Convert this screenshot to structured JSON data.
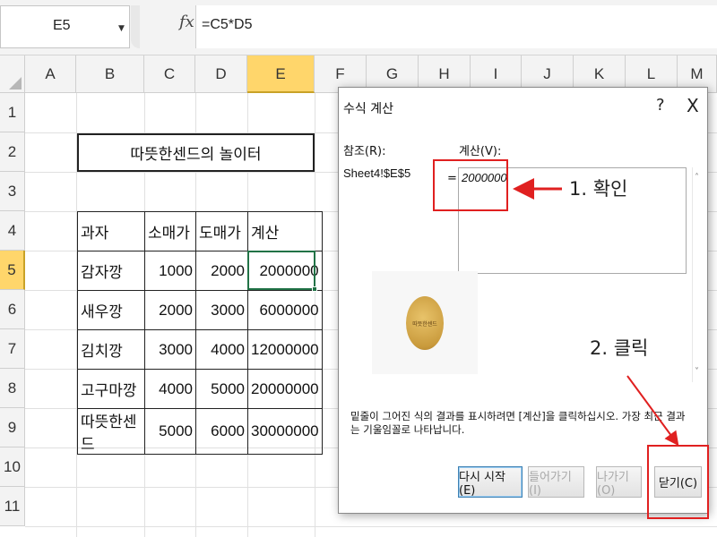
{
  "formula_bar": {
    "name_box": "E5",
    "fx_icon": "fx",
    "formula": "=C5*D5"
  },
  "columns": [
    "A",
    "B",
    "C",
    "D",
    "E",
    "F",
    "G",
    "H",
    "I",
    "J",
    "K",
    "L",
    "M"
  ],
  "rows": [
    "1",
    "2",
    "3",
    "4",
    "5",
    "6",
    "7",
    "8",
    "9",
    "10",
    "11"
  ],
  "active_cell": {
    "column": "E",
    "row": "5"
  },
  "sheet": {
    "title": "따뜻한센드의 놀이터",
    "headers": [
      "과자",
      "소매가",
      "도매가",
      "계산"
    ],
    "table": [
      [
        "감자깡",
        "1000",
        "2000",
        "2000000"
      ],
      [
        "새우깡",
        "2000",
        "3000",
        "6000000"
      ],
      [
        "김치깡",
        "3000",
        "4000",
        "12000000"
      ],
      [
        "고구마깡",
        "4000",
        "5000",
        "20000000"
      ],
      [
        "따뜻한센드",
        "5000",
        "6000",
        "30000000"
      ]
    ]
  },
  "dialog": {
    "title": "수식 계산",
    "help": "?",
    "close": "X",
    "reference_label": "참조(R):",
    "reference_value": "Sheet4!$E$5",
    "equals": "=",
    "evaluation_label": "계산(V):",
    "evaluation_value": "2000000",
    "logo_text": "따뜻한센드",
    "description": "밑줄이 그어진 식의 결과를 표시하려면 [계산]을 클릭하십시오. 가장 최근 결과는 기울임꼴로 나타납니다.",
    "buttons": {
      "restart": "다시 시작(E)",
      "step_in": "들어가기(I)",
      "step_out": "나가기(O)",
      "close": "닫기(C)"
    },
    "scroll_up": "˄",
    "scroll_down": "˅"
  },
  "annotations": {
    "step1": "1. 확인",
    "step2": "2. 클릭",
    "color": "#e02020"
  },
  "colors": {
    "active_header": "#ffd66b",
    "selection": "#217346"
  }
}
